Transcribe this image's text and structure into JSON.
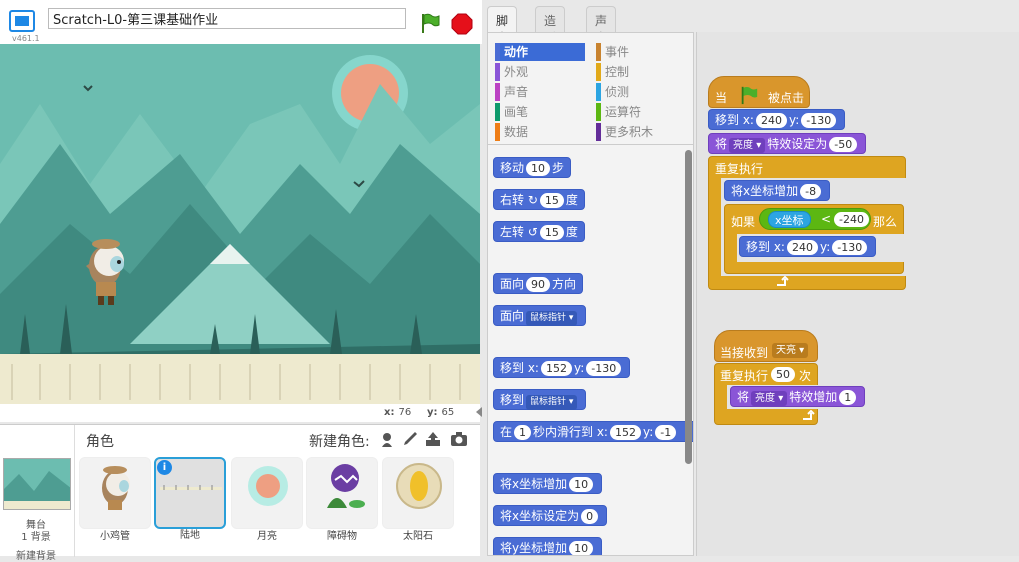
{
  "app": {
    "version": "v461.1",
    "project_title": "Scratch-L0-第三课基础作业"
  },
  "stage": {
    "x_label": "x:",
    "x_value": "76",
    "y_label": "y:",
    "y_value": "65"
  },
  "sprites": {
    "title": "角色",
    "new_sprite_label": "新建角色:",
    "stage_label": "舞台",
    "backdrop_count": "1 背景",
    "new_backdrop": "新建背景",
    "items": [
      {
        "name": "小鸡管"
      },
      {
        "name": "陆地"
      },
      {
        "name": "月亮"
      },
      {
        "name": "障碍物"
      },
      {
        "name": "太阳石"
      }
    ]
  },
  "tabs": [
    "脚本",
    "造型",
    "声音"
  ],
  "categories": [
    {
      "label": "动作",
      "color": "#4a6cd4"
    },
    {
      "label": "外观",
      "color": "#8a55d7"
    },
    {
      "label": "声音",
      "color": "#bb42c3"
    },
    {
      "label": "画笔",
      "color": "#0e9a6c"
    },
    {
      "label": "数据",
      "color": "#ee7d16"
    },
    {
      "label": "事件",
      "color": "#c88330"
    },
    {
      "label": "控制",
      "color": "#e1a91a"
    },
    {
      "label": "侦测",
      "color": "#2ca5e2"
    },
    {
      "label": "运算符",
      "color": "#5cb712"
    },
    {
      "label": "更多积木",
      "color": "#632d99"
    }
  ],
  "palette": {
    "move": {
      "a": "移动",
      "n": "10",
      "b": "步"
    },
    "turn_right": {
      "a": "右转",
      "n": "15",
      "b": "度"
    },
    "turn_left": {
      "a": "左转",
      "n": "15",
      "b": "度"
    },
    "point_dir": {
      "a": "面向",
      "n": "90",
      "b": "方向"
    },
    "point_towards": {
      "a": "面向",
      "dd": "鼠标指针"
    },
    "goto_xy": {
      "a": "移到 x:",
      "x": "152",
      "y_lbl": "y:",
      "y": "-130"
    },
    "goto": {
      "a": "移到",
      "dd": "鼠标指针"
    },
    "glide": {
      "a": "在",
      "n": "1",
      "b": "秒内滑行到 x:",
      "x": "152",
      "y_lbl": "y:",
      "y": "-1"
    },
    "change_x": {
      "a": "将x坐标增加",
      "n": "10"
    },
    "set_x": {
      "a": "将x坐标设定为",
      "n": "0"
    },
    "change_y": {
      "a": "将y坐标增加",
      "n": "10"
    }
  },
  "script1": {
    "hat_a": "当",
    "hat_b": "被点击",
    "goto_a": "移到 x:",
    "goto_x": "240",
    "goto_y_lbl": "y:",
    "goto_y": "-130",
    "set_a": "将",
    "set_dd": "亮度",
    "set_b": "特效设定为",
    "set_n": "-50",
    "forever": "重复执行",
    "chx_a": "将x坐标增加",
    "chx_n": "-8",
    "if_a": "如果",
    "if_var": "x坐标",
    "if_op": "<",
    "if_n": "-240",
    "if_b": "那么",
    "goto2_a": "移到 x:",
    "goto2_x": "240",
    "goto2_y_lbl": "y:",
    "goto2_y": "-130"
  },
  "script2": {
    "hat_a": "当接收到",
    "hat_dd": "天亮",
    "repeat_a": "重复执行",
    "repeat_n": "50",
    "repeat_b": "次",
    "eff_a": "将",
    "eff_dd": "亮度",
    "eff_b": "特效增加",
    "eff_n": "1"
  }
}
